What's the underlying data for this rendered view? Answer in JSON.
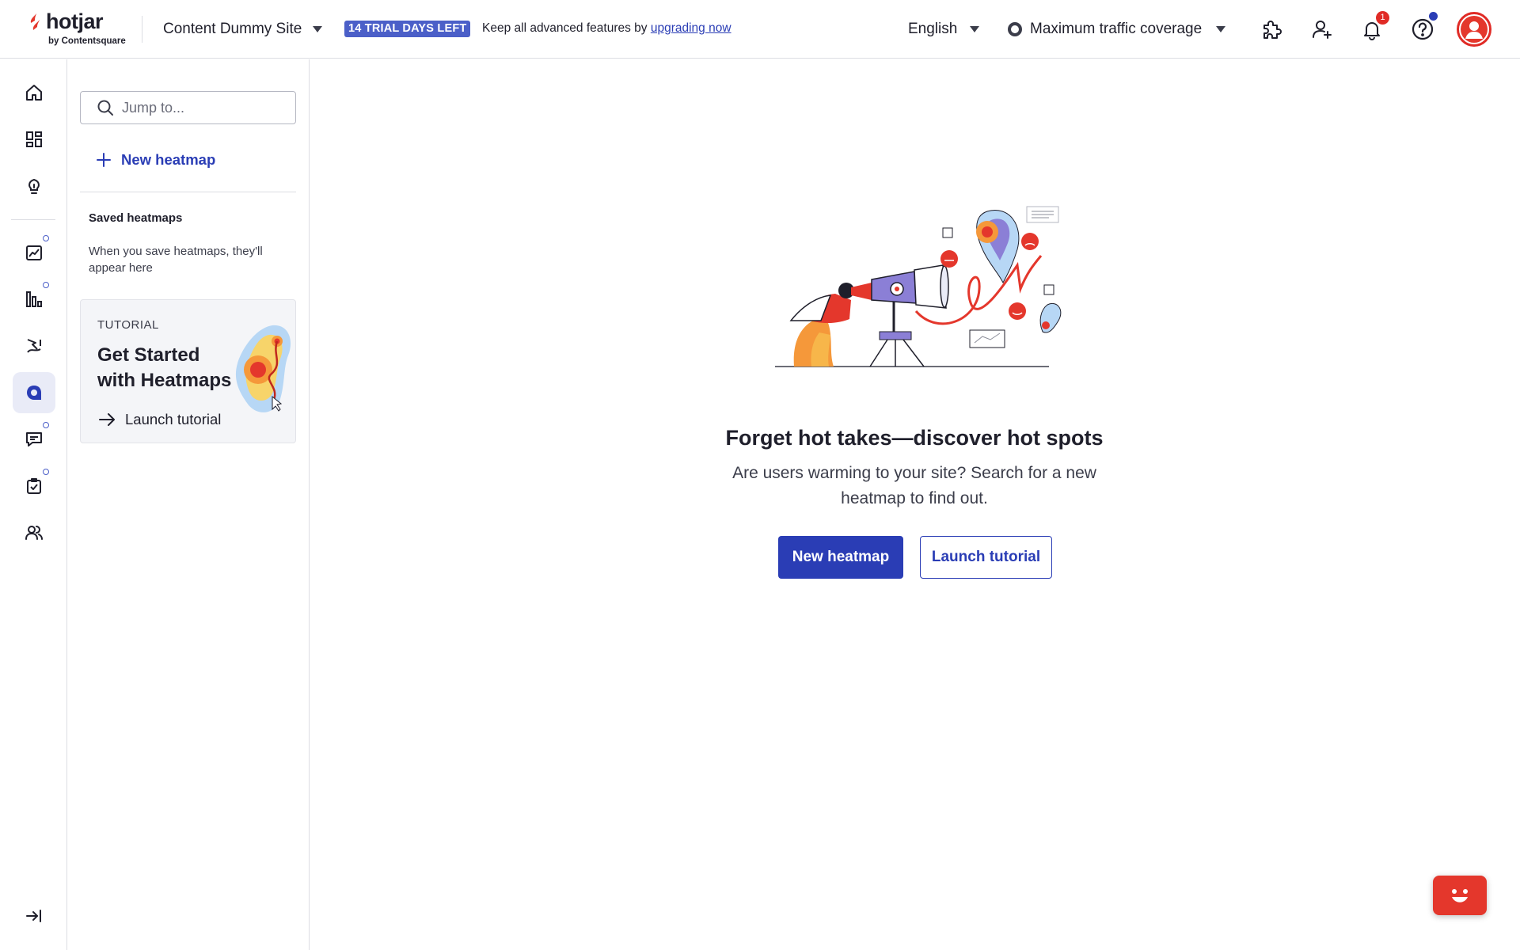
{
  "brand": {
    "name": "hotjar",
    "subtitle": "by Contentsquare",
    "accent": "#2a3db5",
    "logo_color": "#e4372c"
  },
  "topbar": {
    "site_name": "Content Dummy Site",
    "trial_badge": "14 TRIAL DAYS LEFT",
    "trial_message": "Keep all advanced features by ",
    "trial_link": "upgrading now",
    "language": "English",
    "traffic": "Maximum traffic coverage",
    "notification_count": "1",
    "icons": [
      "puzzle-icon",
      "add-user-icon",
      "bell-icon",
      "help-icon",
      "user-avatar-icon"
    ]
  },
  "rail": {
    "items": [
      "home-icon",
      "dashboards-icon",
      "lightbulb-icon",
      "trends-icon",
      "funnels-icon",
      "recordings-icon",
      "heatmaps-icon",
      "feedback-icon",
      "surveys-icon",
      "interviews-icon"
    ],
    "active": "heatmaps-icon",
    "collapse_icon": "collapse-sidebar-icon"
  },
  "panel": {
    "search_placeholder": "Jump to...",
    "new_heatmap_label": "New heatmap",
    "saved_title": "Saved heatmaps",
    "saved_description": "When you save heatmaps, they'll appear here",
    "tutorial": {
      "label": "TUTORIAL",
      "title": "Get Started with Heatmaps",
      "link": "Launch tutorial"
    }
  },
  "main": {
    "title": "Forget hot takes—discover hot spots",
    "description": "Are users warming to your site? Search for a new heatmap to find out.",
    "primary_button": "New heatmap",
    "secondary_button": "Launch tutorial"
  }
}
